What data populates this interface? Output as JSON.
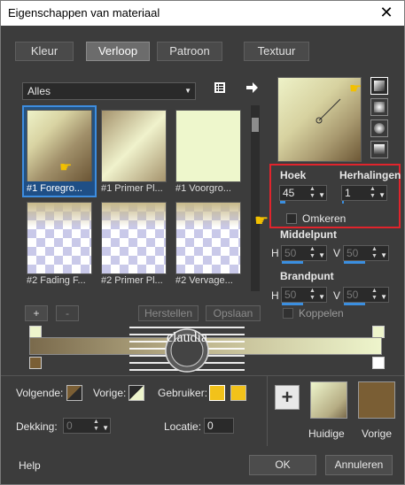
{
  "window": {
    "title": "Eigenschappen van materiaal",
    "close_glyph": "✕"
  },
  "tabs": [
    {
      "label": "Kleur",
      "active": false
    },
    {
      "label": "Verloop",
      "active": true
    },
    {
      "label": "Patroon",
      "active": false
    },
    {
      "label": "Textuur",
      "active": false
    }
  ],
  "category": {
    "value": "Alles"
  },
  "swatches": [
    {
      "label": "#1 Foregro...",
      "selected": true
    },
    {
      "label": "#1 Primer Pl...",
      "selected": false
    },
    {
      "label": "#1 Voorgro...",
      "selected": false
    },
    {
      "label": "#2 Fading F...",
      "selected": false
    },
    {
      "label": "#2 Primer Pl...",
      "selected": false
    },
    {
      "label": "#2 Vervage...",
      "selected": false
    }
  ],
  "list_buttons": {
    "add": "+",
    "remove": "-",
    "reset": "Herstellen",
    "save": "Opslaan"
  },
  "settings": {
    "angle_label": "Hoek",
    "angle_value": "45",
    "repeats_label": "Herhalingen",
    "repeats_value": "1",
    "invert_label": "Omkeren",
    "midpoint_label": "Middelpunt",
    "mid_h_label": "H",
    "mid_h_value": "50",
    "mid_v_label": "V",
    "mid_v_value": "50",
    "focal_label": "Brandpunt",
    "focal_h_label": "H",
    "focal_h_value": "50",
    "focal_v_label": "V",
    "focal_v_value": "50",
    "link_label": "Koppelen"
  },
  "bottom": {
    "follow_label": "Volgende:",
    "previous_label": "Vorige:",
    "user_label": "Gebruiker:",
    "opacity_label": "Dekking:",
    "opacity_value": "0",
    "location_label": "Locatie:",
    "location_value": "0",
    "current_label": "Huidige",
    "previous_swatch_label": "Vorige",
    "watermark_text": "claudia"
  },
  "footer": {
    "help": "Help",
    "ok": "OK",
    "cancel": "Annuleren"
  },
  "colors": {
    "accent": "#3b8fe0",
    "highlight_border": "#e1242c",
    "foreground": "#eef5cc",
    "background": "#7a5e34",
    "user_chip": "#f2c21a"
  },
  "icons": {
    "library": "library-icon",
    "arrow": "arrow-right-icon",
    "linear": "linear-style-icon",
    "rectangular": "rectangular-style-icon",
    "sunburst": "sunburst-style-icon",
    "radial": "radial-style-icon",
    "pointer": "pointing-hand-icon"
  }
}
